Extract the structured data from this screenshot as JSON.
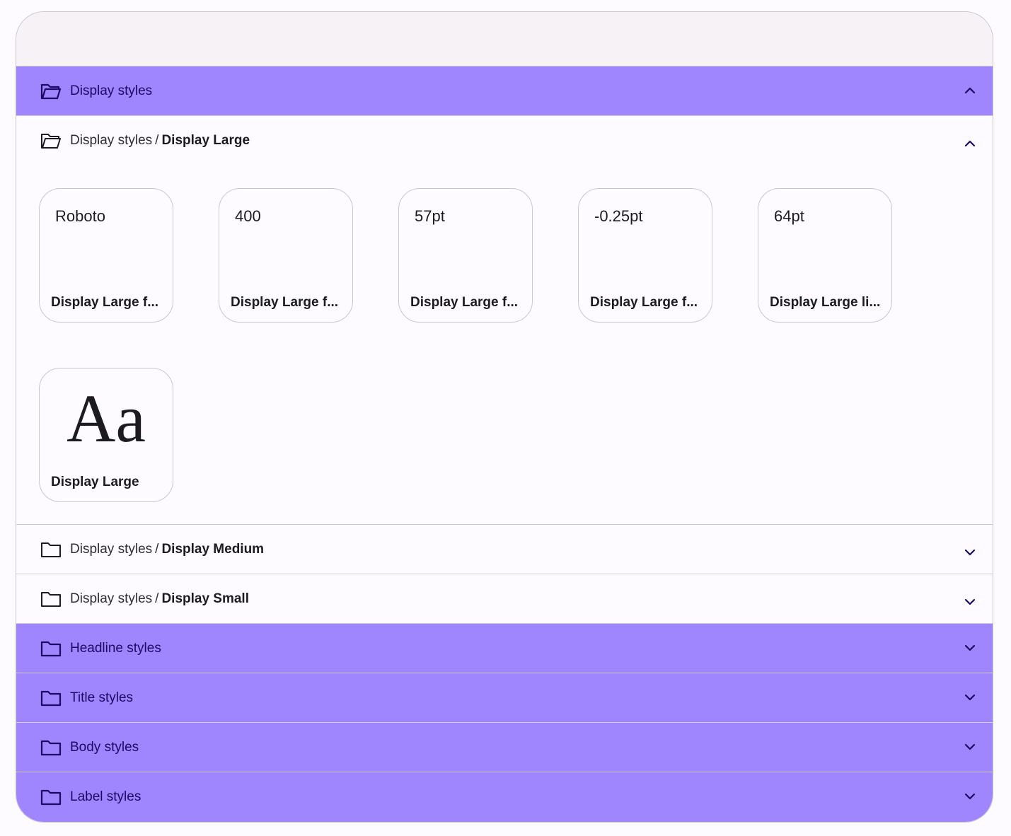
{
  "groups": [
    {
      "label": "Display styles",
      "expanded": true
    },
    {
      "label": "Headline styles",
      "expanded": false
    },
    {
      "label": "Title styles",
      "expanded": false
    },
    {
      "label": "Body styles",
      "expanded": false
    },
    {
      "label": "Label styles",
      "expanded": false
    }
  ],
  "subgroups": [
    {
      "parent": "Display styles",
      "separator": "/",
      "label": "Display Large",
      "expanded": true
    },
    {
      "parent": "Display styles",
      "separator": "/",
      "label": "Display Medium",
      "expanded": false
    },
    {
      "parent": "Display styles",
      "separator": "/",
      "label": "Display Small",
      "expanded": false
    }
  ],
  "cards": [
    {
      "value": "Roboto",
      "caption": "Display Large f..."
    },
    {
      "value": "400",
      "caption": "Display Large f..."
    },
    {
      "value": "57pt",
      "caption": "Display Large f..."
    },
    {
      "value": "-0.25pt",
      "caption": "Display Large f..."
    },
    {
      "value": "64pt",
      "caption": "Display Large li..."
    }
  ],
  "sample_card": {
    "sample": "Aa",
    "caption": "Display Large"
  },
  "colors": {
    "accent_row": "#9f86ff",
    "accent_text": "#1d0863",
    "surface": "#fdfbff",
    "outline": "#cac6d0"
  },
  "icons": {
    "open_folder": "folder-open-icon",
    "closed_folder": "folder-icon",
    "expand": "chevron-down-icon",
    "collapse": "chevron-up-icon"
  }
}
